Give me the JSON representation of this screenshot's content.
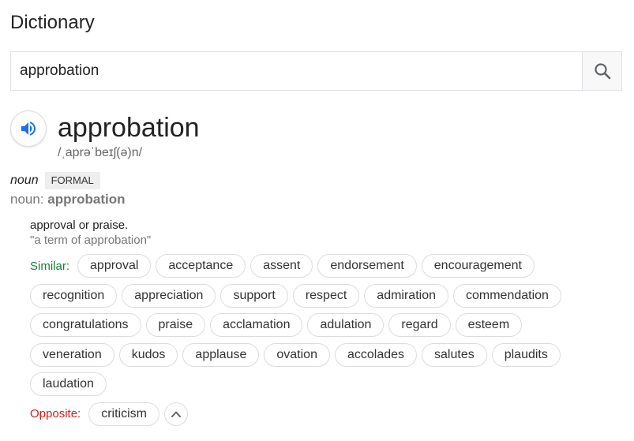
{
  "header": {
    "title": "Dictionary"
  },
  "search": {
    "value": "approbation",
    "icon": "search-icon"
  },
  "entry": {
    "headword": "approbation",
    "phonetic": "/ˌaprəˈbeɪʃ(ə)n/",
    "part_of_speech": "noun",
    "register": "FORMAL",
    "forms_label": "noun: ",
    "forms_word": "approbation",
    "definition": "approval or praise.",
    "example": "\"a term of approbation\""
  },
  "similar": {
    "label": "Similar:",
    "rows": [
      [
        "approval",
        "acceptance",
        "assent",
        "endorsement",
        "encouragement"
      ],
      [
        "recognition",
        "appreciation",
        "support",
        "respect",
        "admiration",
        "commendation"
      ],
      [
        "congratulations",
        "praise",
        "acclamation",
        "adulation",
        "regard",
        "esteem"
      ],
      [
        "veneration",
        "kudos",
        "applause",
        "ovation",
        "accolades",
        "salutes",
        "plaudits"
      ],
      [
        "laudation"
      ]
    ]
  },
  "opposite": {
    "label": "Opposite:",
    "words": [
      "criticism"
    ]
  },
  "colors": {
    "similar": "#188038",
    "opposite": "#c5221f",
    "speaker": "#1a73e8"
  }
}
